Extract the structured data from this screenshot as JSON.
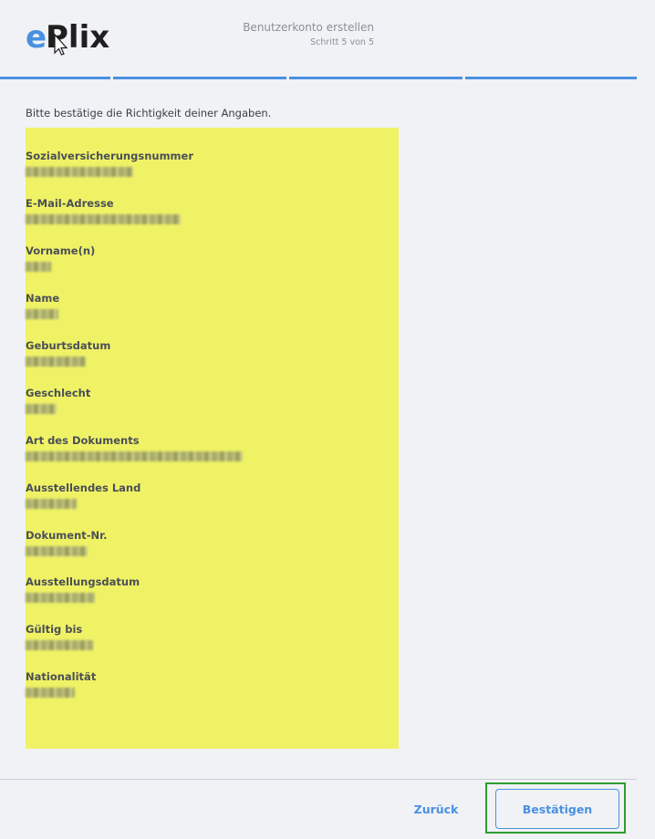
{
  "header": {
    "logo_text": "ePlix",
    "title": "Benutzerkonto erstellen",
    "step": "Schritt 5 von 5"
  },
  "progress": {
    "steps_total": 4,
    "steps_completed": 4,
    "color": "#4a90e2"
  },
  "intro": "Bitte bestätige die Richtigkeit deiner Angaben.",
  "fields": [
    {
      "label": "Sozialversicherungsnummer",
      "value_redacted": true
    },
    {
      "label": "E-Mail-Adresse",
      "value_redacted": true
    },
    {
      "label": "Vorname(n)",
      "value_redacted": true
    },
    {
      "label": "Name",
      "value_redacted": true
    },
    {
      "label": "Geburtsdatum",
      "value_redacted": true
    },
    {
      "label": "Geschlecht",
      "value_redacted": true
    },
    {
      "label": "Art des Dokuments",
      "value_redacted": true
    },
    {
      "label": "Ausstellendes Land",
      "value_redacted": true
    },
    {
      "label": "Dokument-Nr.",
      "value_redacted": true
    },
    {
      "label": "Ausstellungsdatum",
      "value_redacted": true
    },
    {
      "label": "Gültig bis",
      "value_redacted": true
    },
    {
      "label": "Nationalität",
      "value_redacted": true
    }
  ],
  "footer": {
    "back_label": "Zurück",
    "confirm_label": "Bestätigen"
  },
  "colors": {
    "accent": "#4a90e2",
    "highlight": "#f0f266",
    "focus_outline": "#2f9c2f"
  }
}
